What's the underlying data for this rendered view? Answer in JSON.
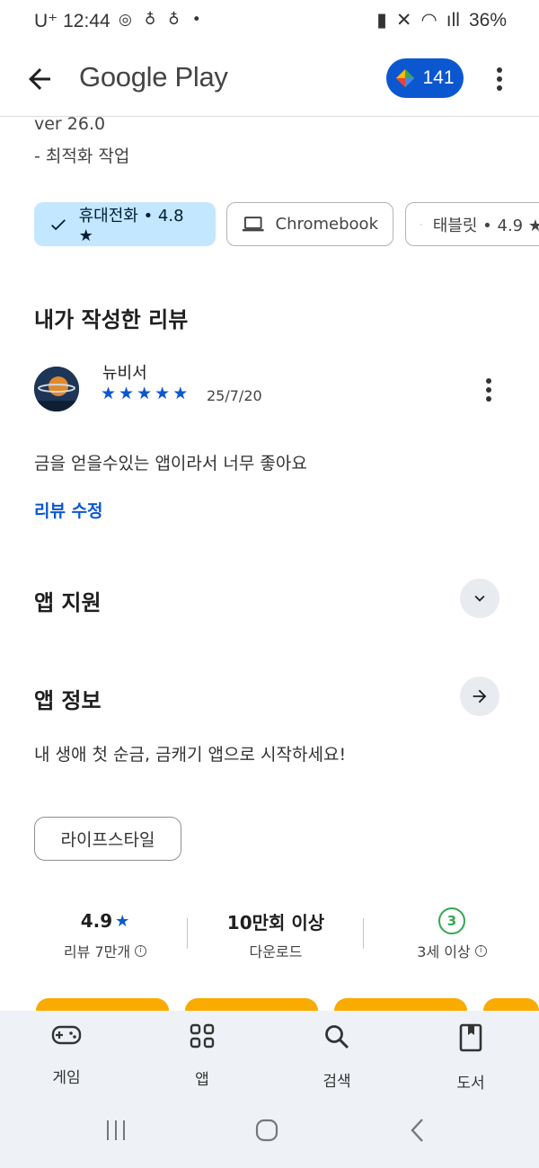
{
  "status_bar": {
    "carrier": "U⁺",
    "time": "12:44",
    "battery": "36%"
  },
  "app_bar": {
    "title": "Google Play",
    "points": "141"
  },
  "release_notes": {
    "version": "ver 26.0",
    "item": "- 최적화 작업"
  },
  "device_chips": [
    {
      "label": "휴대전화 • 4.8 ★",
      "selected": true
    },
    {
      "label": "Chromebook",
      "selected": false
    },
    {
      "label": "태블릿 • 4.9 ★",
      "selected": false
    }
  ],
  "my_review": {
    "heading": "내가 작성한 리뷰",
    "reviewer": "뉴비서",
    "stars": 5,
    "date": "25/7/20",
    "text": "금을 얻을수있는 앱이라서 너무 좋아요",
    "edit_label": "리뷰 수정"
  },
  "app_support": {
    "heading": "앱 지원"
  },
  "app_info": {
    "heading": "앱 정보",
    "description": "내 생애 첫 순금, 금캐기 앱으로 시작하세요!",
    "category_tag": "라이프스타일"
  },
  "stats": {
    "rating": "4.9",
    "reviews_label": "리뷰 7만개",
    "downloads": "10만회 이상",
    "downloads_label": "다운로드",
    "age_rating": "3",
    "age_label": "3세 이상"
  },
  "bottom_nav": {
    "items": [
      "게임",
      "앱",
      "검색",
      "도서"
    ]
  },
  "colors": {
    "accent": "#0b57d0",
    "chip_selected": "#c2e7ff",
    "card": "#f9ab00",
    "nav_bg": "#eef2f7"
  }
}
